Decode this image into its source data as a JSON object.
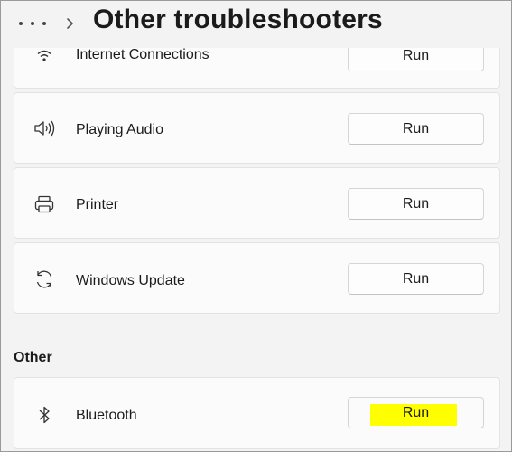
{
  "header": {
    "more_icon": "more-dots-icon",
    "chevron_icon": "chevron-right-icon",
    "title": "Other troubleshooters"
  },
  "items": [
    {
      "label": "Internet Connections",
      "icon": "wifi-icon",
      "button": "Run"
    },
    {
      "label": "Playing Audio",
      "icon": "speaker-icon",
      "button": "Run"
    },
    {
      "label": "Printer",
      "icon": "printer-icon",
      "button": "Run"
    },
    {
      "label": "Windows Update",
      "icon": "sync-icon",
      "button": "Run"
    }
  ],
  "other_section": {
    "heading": "Other",
    "items": [
      {
        "label": "Bluetooth",
        "icon": "bluetooth-icon",
        "button": "Run",
        "highlight_color": "#ffff00"
      }
    ]
  }
}
